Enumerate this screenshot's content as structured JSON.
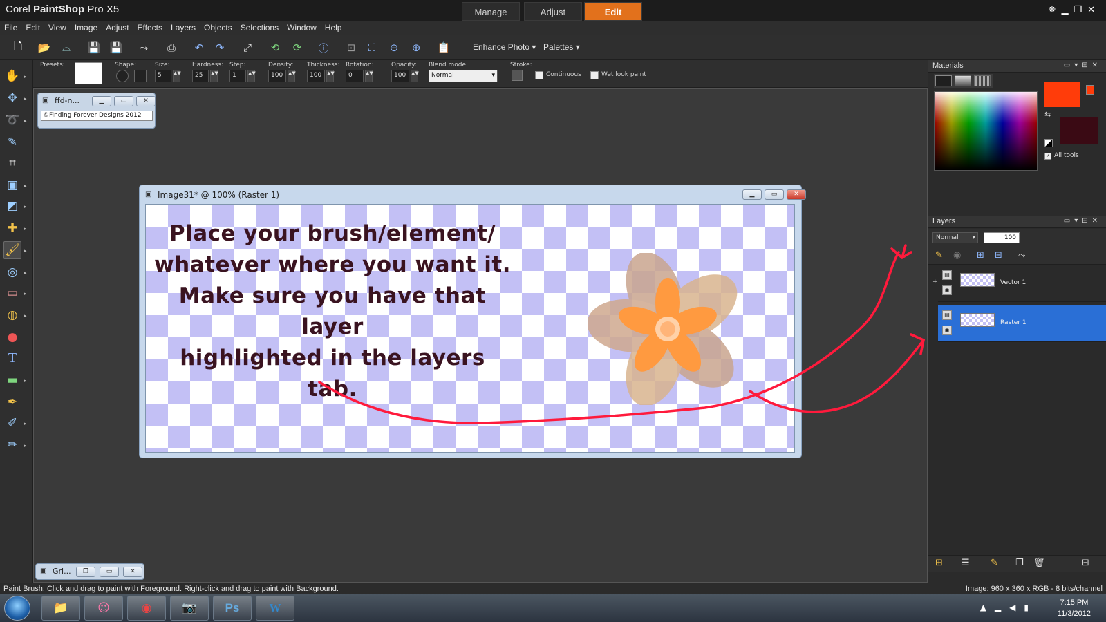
{
  "app": {
    "title_prefix": "Corel ",
    "title_bold": "PaintShop",
    "title_suffix": " Pro X5"
  },
  "workspace_tabs": [
    {
      "label": "Manage"
    },
    {
      "label": "Adjust"
    },
    {
      "label": "Edit"
    }
  ],
  "menu": [
    "File",
    "Edit",
    "View",
    "Image",
    "Adjust",
    "Effects",
    "Layers",
    "Objects",
    "Selections",
    "Window",
    "Help"
  ],
  "toolbar": {
    "enhance_photo": "Enhance Photo",
    "palettes": "Palettes"
  },
  "options": {
    "presets_label": "Presets:",
    "shape_label": "Shape:",
    "size_label": "Size:",
    "size_value": "5",
    "hardness_label": "Hardness:",
    "hardness_value": "25",
    "step_label": "Step:",
    "step_value": "1",
    "density_label": "Density:",
    "density_value": "100",
    "thickness_label": "Thickness:",
    "thickness_value": "100",
    "rotation_label": "Rotation:",
    "rotation_value": "0",
    "opacity_label": "Opacity:",
    "opacity_value": "100",
    "blend_label": "Blend mode:",
    "blend_value": "Normal",
    "stroke_label": "Stroke:",
    "continuous_label": "Continuous",
    "wetlook_label": "Wet look paint"
  },
  "mini_doc_1": {
    "title": "ffd-n...",
    "content": "©Finding Forever Designs 2012"
  },
  "mini_doc_2": {
    "title": "Gri..."
  },
  "image_window": {
    "title": "Image31* @ 100% (Raster 1)",
    "canvas_text": [
      "Place your brush/element/",
      "whatever where you want it.",
      "Make sure you have that layer",
      "highlighted in the layers",
      "tab."
    ]
  },
  "materials": {
    "title": "Materials",
    "all_tools": "All tools",
    "foreground": "#ff3c0a",
    "background": "#3a0a14"
  },
  "layers": {
    "title": "Layers",
    "blend": "Normal",
    "opacity": "100",
    "rows": [
      {
        "name": "Vector 1",
        "selected": false
      },
      {
        "name": "Raster 1",
        "selected": true
      }
    ]
  },
  "status": {
    "left": "Paint Brush: Click and drag to paint with Foreground. Right-click and drag to paint with Background.",
    "right": "Image:  960 x 360 x RGB - 8 bits/channel"
  },
  "taskbar": {
    "time": "7:15 PM",
    "date": "11/3/2012"
  },
  "colors": {
    "accent_tab": "#e2711c",
    "annotation": "#ff1a3c",
    "layer_selected": "#2a6fd6"
  }
}
